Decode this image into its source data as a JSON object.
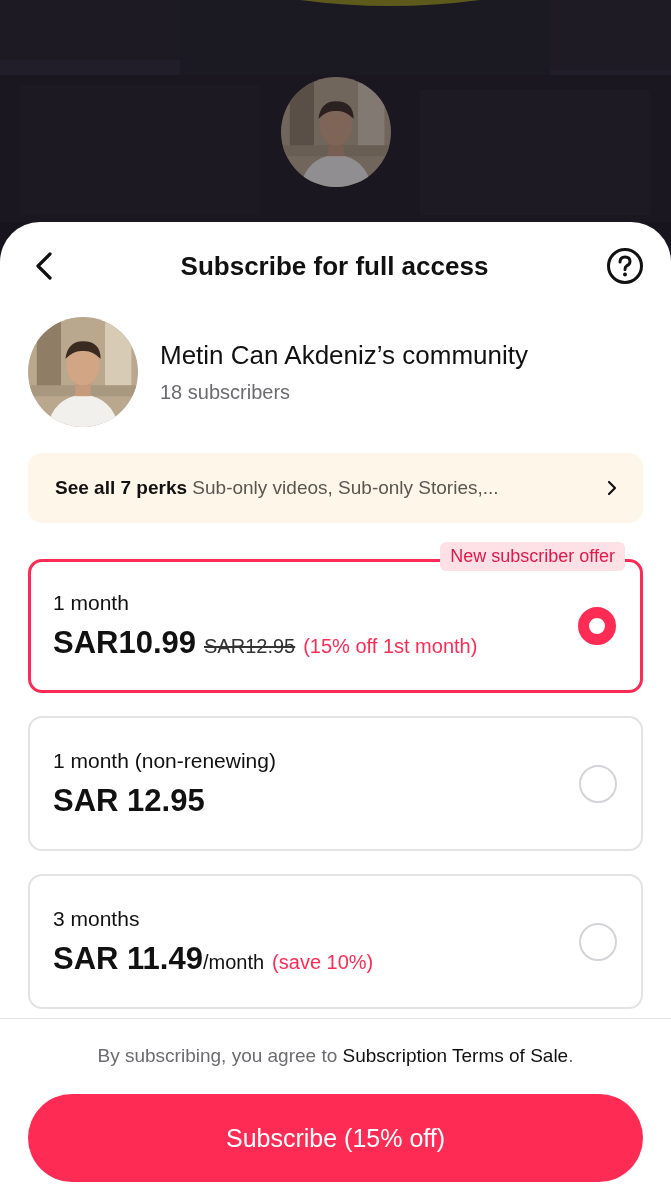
{
  "header": {
    "title": "Subscribe for full access"
  },
  "community": {
    "name": "Metin Can Akdeniz’s community",
    "subscribers": "18 subscribers"
  },
  "perks": {
    "summary": "**See all 7 perks** Sub-only videos, Sub-only Stories,..."
  },
  "plans": [
    {
      "label": "1 month",
      "price": "SAR10.99",
      "old_price": "SAR12.95",
      "note": "(15% off 1st month)",
      "badge": "New subscriber offer",
      "selected": true
    },
    {
      "label": "1 month (non-renewing)",
      "price": "SAR 12.95",
      "selected": false
    },
    {
      "label": "3 months",
      "price": "SAR 11.49",
      "unit": "/month",
      "note": "(save 10%)",
      "selected": false
    }
  ],
  "terms": {
    "text": "By subscribing, you agree to",
    "link": "Subscription Terms of Sale",
    "end": "."
  },
  "subscribe_button": "Subscribe (15% off)"
}
